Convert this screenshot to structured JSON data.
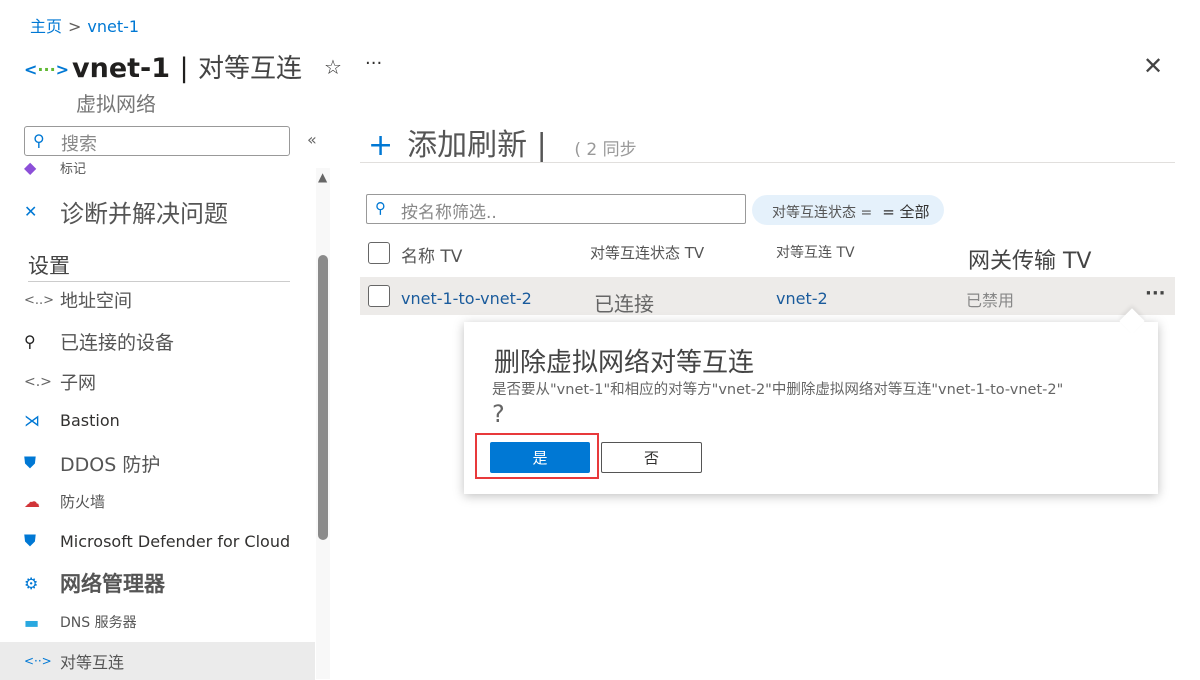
{
  "breadcrumb": {
    "home": "主页",
    "separator": ">",
    "current": "vnet-1"
  },
  "header": {
    "resource": "vnet-1",
    "separator": "|",
    "page": "对等互连",
    "subtitle": "虚拟网络",
    "star": "☆",
    "more": "···",
    "close": "✕"
  },
  "sidebar": {
    "search_placeholder": "搜索",
    "collapse": "«",
    "items": [
      {
        "label": "标记",
        "icon": "tag-icon",
        "glyph": "◆",
        "color": "#8c4fd8"
      },
      {
        "label": "诊断并解决问题",
        "icon": "wrench-icon",
        "glyph": "✕",
        "color": "#0078d4"
      },
      {
        "label": "设置"
      },
      {
        "label": "地址空间",
        "icon": "address-space-icon",
        "glyph": "<..>",
        "color": "#666"
      },
      {
        "label": "已连接的设备",
        "icon": "plug-icon",
        "glyph": "⚲",
        "color": "#222"
      },
      {
        "label": "子网",
        "icon": "subnet-icon",
        "glyph": "<.>",
        "color": "#666"
      },
      {
        "label": "Bastion",
        "icon": "bastion-icon",
        "glyph": "⋊",
        "color": "#0078d4"
      },
      {
        "label": "DDOS 防护",
        "icon": "shield-icon",
        "glyph": "⛊",
        "color": "#0078d4"
      },
      {
        "label": "防火墙",
        "icon": "firewall-icon",
        "glyph": "☁",
        "color": "#d13438"
      },
      {
        "label": "Microsoft Defender for Cloud",
        "icon": "defender-shield-icon",
        "glyph": "⛊",
        "color": "#0078d4"
      },
      {
        "label": "网络管理器",
        "icon": "network-manager-icon",
        "glyph": "⚙",
        "color": "#0078d4"
      },
      {
        "label": "DNS 服务器",
        "icon": "dns-icon",
        "glyph": "▬",
        "color": "#29a8e0"
      },
      {
        "label": "对等互连",
        "icon": "peering-icon",
        "glyph": "<··>",
        "color": "#0078d4"
      }
    ]
  },
  "toolbar": {
    "add": "添加",
    "refresh": "刷新",
    "sync": "同步",
    "sync_count": "2"
  },
  "filter": {
    "placeholder": "按名称筛选..",
    "pill_label": "对等互连状态 =",
    "pill_value": "= 全部"
  },
  "table": {
    "columns": [
      "名称 TV",
      "对等互连状态 TV",
      "对等互连 TV",
      "网关传输 TV"
    ],
    "rows": [
      {
        "name": "vnet-1-to-vnet-2",
        "status": "已连接",
        "peer": "vnet-2",
        "gateway": "已禁用",
        "more": "···"
      }
    ]
  },
  "dialog": {
    "title": "删除虚拟网络对等互连",
    "message": "是否要从\"vnet-1\"和相应的对等方\"vnet-2\"中删除虚拟网络对等互连\"vnet-1-to-vnet-2\"",
    "question": "?",
    "yes": "是",
    "no": "否"
  }
}
